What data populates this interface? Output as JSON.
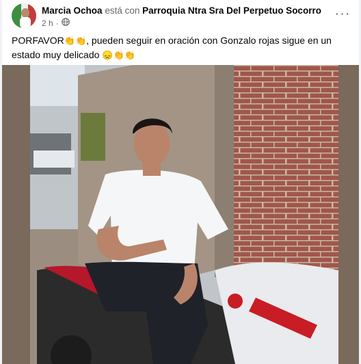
{
  "post": {
    "author": "Marcia Ochoa",
    "connector": "está con",
    "tagged": "Parroquia Ntra Sra Del Perpetuo Socorro",
    "time": "2 h",
    "separator": "·",
    "audience_icon": "globe-icon",
    "more_icon": "more-options-icon",
    "more_label": "···",
    "caption_parts": {
      "p1": "PORFAVOR",
      "e1": "👏👏",
      "p2": ", pueden seguir en oración con Gonzalo rojas sigue en un estado muy delicado ",
      "e2": "😞👏👏"
    }
  },
  "colors": {
    "primary_text": "#050505",
    "secondary_text": "#65676b",
    "background": "#f0f2f5"
  }
}
